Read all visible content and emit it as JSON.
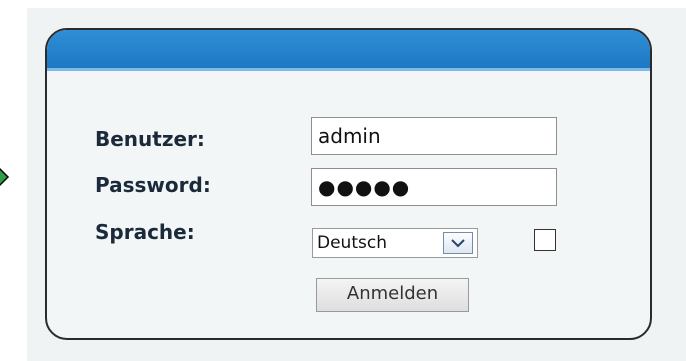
{
  "colors": {
    "header": "#1e78c4",
    "background": "#f0f3f3",
    "arrow": "#2ea043"
  },
  "icons": {
    "pointer": "arrow-right-icon",
    "dropdown": "chevron-down-icon"
  },
  "login": {
    "username_label": "Benutzer:",
    "password_label": "Password:",
    "language_label": "Sprache:",
    "username_value": "admin",
    "password_value": "●●●●●",
    "language_value": "Deutsch",
    "checkbox_checked": false,
    "submit_label": "Anmelden"
  }
}
